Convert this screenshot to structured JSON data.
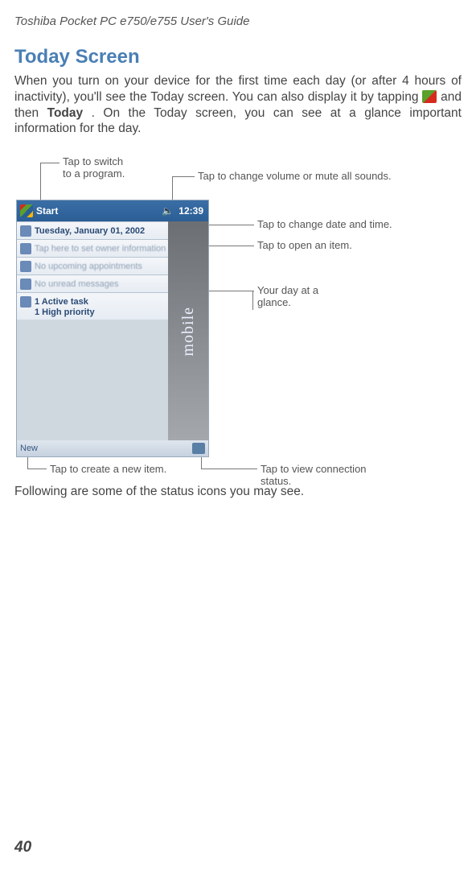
{
  "header": "Toshiba Pocket PC e750/e755  User's Guide",
  "title": "Today Screen",
  "intro": {
    "part1": "When you turn on your device for the first time each day (or after 4 hours of inactivity), you'll see the Today screen. You can also display it by tapping ",
    "part2": " and then  ",
    "today_bold": "Today",
    "part3": ". On the Today screen, you can see at a glance important information for the day."
  },
  "callouts": {
    "switch_program": "Tap to switch\nto a program.",
    "volume": "Tap to change volume or mute all sounds.",
    "date_time": "Tap to change date and time.",
    "open_item": "Tap to open an item.",
    "day_glance": "Your day at a\nglance.",
    "new_item": "Tap to create a new item.",
    "connection": "Tap to view connection\nstatus."
  },
  "screenshot": {
    "start_label": "Start",
    "clock": "12:39",
    "date_row": "Tuesday, January 01, 2002",
    "owner_row": "Tap here to set owner information",
    "appointments_row": "No upcoming appointments",
    "messages_row": "No unread messages",
    "tasks_line1": "1 Active task",
    "tasks_line2": "1 High priority",
    "bottom_new": "New",
    "strip": "mobile"
  },
  "following": "Following are some of the status icons you may see.",
  "page_num": "40"
}
